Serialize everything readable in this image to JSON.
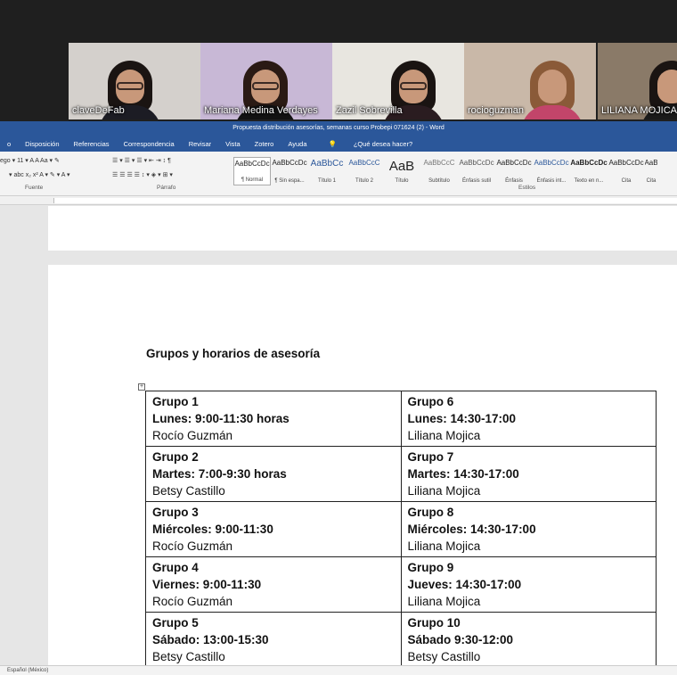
{
  "meeting": {
    "participants": [
      {
        "name": "claveDeFab",
        "bg": "#d4d0cc",
        "shirt": "#1c1c24",
        "hair": "#1a1412"
      },
      {
        "name": "Mariana Medina Verdayes",
        "bg": "#c8b8d6",
        "shirt": "#121212",
        "hair": "#2a1a14"
      },
      {
        "name": "Zazil Sobrevilla",
        "bg": "#e8e6e0",
        "shirt": "#2a1c20",
        "hair": "#1a1412"
      },
      {
        "name": "rocioguzman",
        "bg": "#c9b8a8",
        "shirt": "#c2456a",
        "hair": "#8a5a38"
      },
      {
        "name": "LILIANA MOJICA",
        "bg": "#8a7a68",
        "shirt": "#1a1a1a",
        "hair": "#1a1412"
      }
    ]
  },
  "word": {
    "title": "Propuesta distribución asesorías, semanas curso Probepi 071624 (2)  -  Word",
    "menu": [
      "o",
      "Disposición",
      "Referencias",
      "Correspondencia",
      "Revisar",
      "Vista",
      "Zotero",
      "Ayuda"
    ],
    "tell_me": "¿Qué desea hacer?",
    "ribbon": {
      "font_row": "ego  ▾  11  ▾   A  A   Aa ▾   ✎",
      "format_row": "▾  abc  x₂  x²    A ▾  ✎ ▾  A ▾",
      "para_row1": "☰ ▾  ☰ ▾  ☰ ▾   ⇤  ⇥   ↕  ¶",
      "para_row2": "☰  ☰  ☰  ☰    ↕ ▾   ◈ ▾  ⊞ ▾",
      "groups": {
        "fuente": "Fuente",
        "parrafo": "Párrafo",
        "estilos": "Estilos"
      },
      "styles": [
        {
          "preview": "AaBbCcDc",
          "label": "¶ Normal"
        },
        {
          "preview": "AaBbCcDc",
          "label": "¶ Sin espa..."
        },
        {
          "preview": "AaBbCc",
          "label": "Título 1"
        },
        {
          "preview": "AaBbCcC",
          "label": "Título 2"
        },
        {
          "preview": "AaB",
          "label": "Título"
        },
        {
          "preview": "AaBbCcC",
          "label": "Subtítulo"
        },
        {
          "preview": "AaBbCcDc",
          "label": "Énfasis sutil"
        },
        {
          "preview": "AaBbCcDc",
          "label": "Énfasis"
        },
        {
          "preview": "AaBbCcDc",
          "label": "Énfasis int..."
        },
        {
          "preview": "AaBbCcDc",
          "label": "Texto en n..."
        },
        {
          "preview": "AaBbCcDc",
          "label": "Cita"
        },
        {
          "preview": "AaB",
          "label": "Cita"
        }
      ]
    },
    "document": {
      "heading": "Grupos y horarios de asesoría",
      "rows": [
        [
          {
            "grupo": "Grupo 1",
            "horario": "Lunes: 9:00-11:30 horas",
            "persona": "Rocío Guzmán"
          },
          {
            "grupo": "Grupo 6",
            "horario": "Lunes: 14:30-17:00",
            "persona": "Liliana Mojica"
          }
        ],
        [
          {
            "grupo": "Grupo 2",
            "horario": "Martes: 7:00-9:30 horas",
            "persona": "Betsy Castillo"
          },
          {
            "grupo": "Grupo 7",
            "horario": "Martes: 14:30-17:00",
            "persona": "Liliana Mojica"
          }
        ],
        [
          {
            "grupo": "Grupo 3",
            "horario": "Miércoles: 9:00-11:30",
            "persona": "Rocío Guzmán"
          },
          {
            "grupo": "Grupo 8",
            "horario": "Miércoles: 14:30-17:00",
            "persona": "Liliana Mojica"
          }
        ],
        [
          {
            "grupo": "Grupo 4",
            "horario": "Viernes: 9:00-11:30",
            "persona": "Rocío Guzmán"
          },
          {
            "grupo": "Grupo 9",
            "horario": "Jueves: 14:30-17:00",
            "persona": "Liliana Mojica"
          }
        ],
        [
          {
            "grupo": "Grupo 5",
            "horario": "Sábado: 13:00-15:30",
            "persona": "Betsy Castillo"
          },
          {
            "grupo": "Grupo 10",
            "horario": "Sábado 9:30-12:00",
            "persona": "Betsy Castillo"
          }
        ]
      ]
    },
    "status": "Español (México)"
  }
}
